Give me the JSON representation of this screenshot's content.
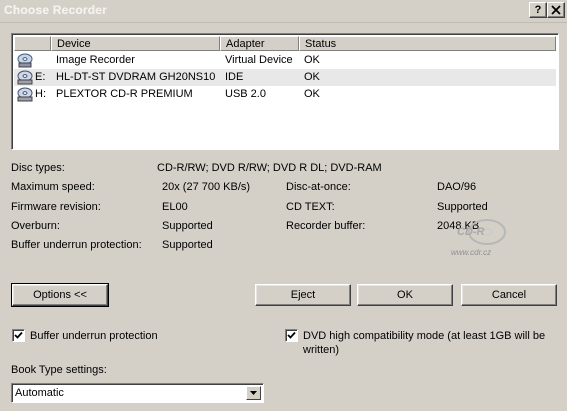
{
  "window": {
    "title": "Choose Recorder",
    "help_label": "?",
    "close_label": "X"
  },
  "list": {
    "columns": [
      "Device",
      "Adapter",
      "Status"
    ],
    "rows": [
      {
        "drive": "",
        "device": "Image Recorder",
        "adapter": "Virtual Device",
        "status": "OK",
        "icon": "image-recorder-icon"
      },
      {
        "drive": "E:",
        "device": "HL-DT-ST DVDRAM GH20NS10",
        "adapter": "IDE",
        "status": "OK",
        "icon": "optical-drive-icon"
      },
      {
        "drive": "H:",
        "device": "PLEXTOR CD-R   PREMIUM",
        "adapter": "USB 2.0",
        "status": "OK",
        "icon": "optical-drive-icon"
      }
    ]
  },
  "info": {
    "disc_types_label": "Disc types:",
    "disc_types_value": "CD-R/RW; DVD R/RW; DVD R DL; DVD-RAM",
    "max_speed_label": "Maximum speed:",
    "max_speed_value": "20x (27 700 KB/s)",
    "dao_label": "Disc-at-once:",
    "dao_value": "DAO/96",
    "firmware_label": "Firmware revision:",
    "firmware_value": "EL00",
    "cdtext_label": "CD TEXT:",
    "cdtext_value": "Supported",
    "overburn_label": "Overburn:",
    "overburn_value": "Supported",
    "buffer_label": "Recorder buffer:",
    "buffer_value": "2048 KB",
    "underrun_label": "Buffer underrun protection:",
    "underrun_value": "Supported"
  },
  "watermark": {
    "text": "CD-R",
    "url": "www.cdr.cz"
  },
  "buttons": {
    "options": "Options <<",
    "eject": "Eject",
    "ok": "OK",
    "cancel": "Cancel"
  },
  "options": {
    "underrun_checkbox": "Buffer underrun protection",
    "underrun_checked": true,
    "dvd_compat_line1": "DVD high compatibility mode (at least 1GB will be",
    "dvd_compat_line2": "written)",
    "dvd_compat_checked": true,
    "booktype_label": "Book Type settings:",
    "booktype_value": "Automatic"
  }
}
